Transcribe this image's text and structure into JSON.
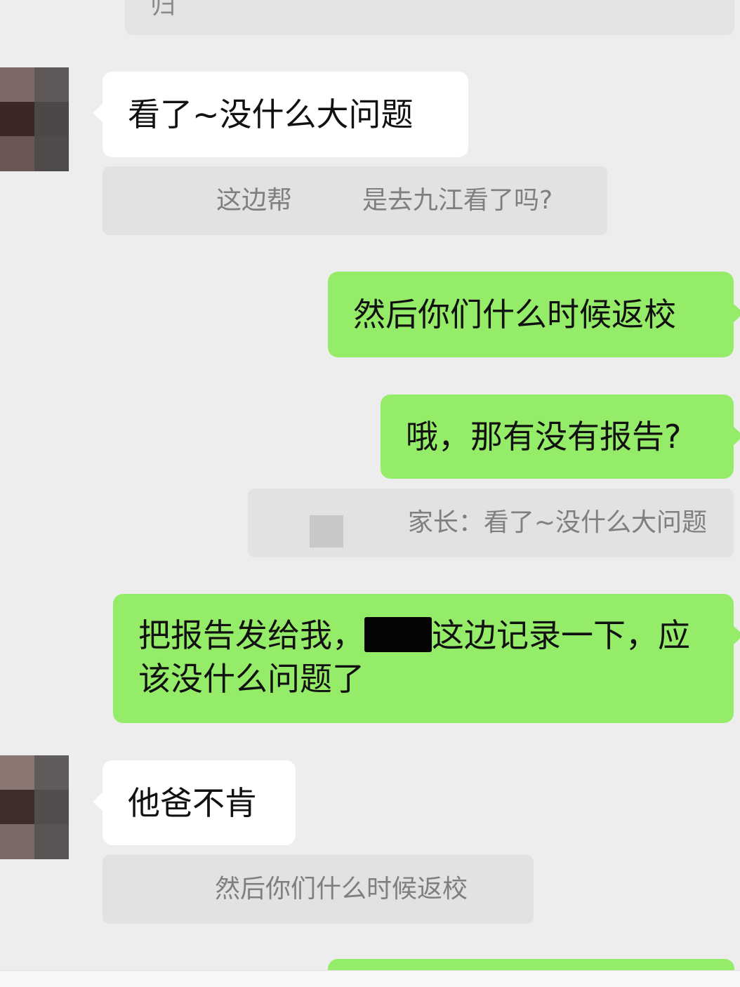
{
  "messages": {
    "top_partial_text": "归",
    "in_1": "看了~没什么大问题",
    "quote_1_left": "这边帮",
    "quote_1_right": "是去九江看了吗?",
    "out_1": "然后你们什么时候返校",
    "out_2": "哦，那有没有报告?",
    "quote_2": "家长：看了~没什么大问题",
    "out_3_part1": "把报告发给我，",
    "out_3_part2": "这边记录一下，应",
    "out_3_line2": "该没什么问题了",
    "in_2": "他爸不肯",
    "quote_3": "然后你们什么时候返校"
  },
  "colors": {
    "background": "#ededed",
    "incoming_bubble": "#ffffff",
    "outgoing_bubble": "#95ec69",
    "quote_bg": "#e2e2e2",
    "quote_text": "#7f7f7f"
  }
}
